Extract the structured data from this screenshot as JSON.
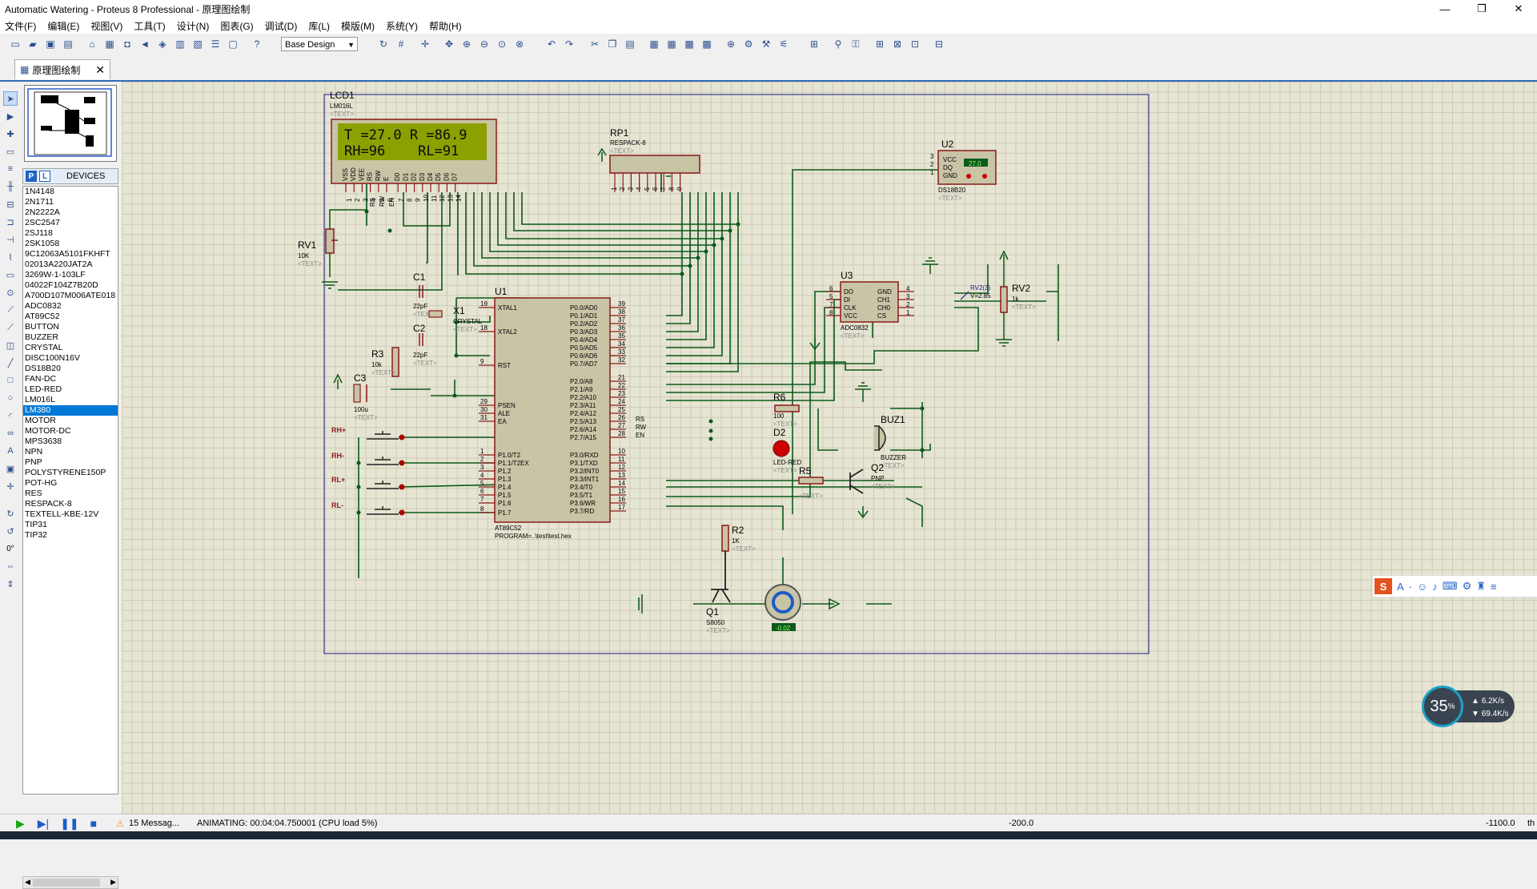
{
  "window": {
    "title": "Automatic Watering - Proteus 8 Professional - 原理图绘制",
    "buttons": [
      "—",
      "❐",
      "✕"
    ]
  },
  "menu": [
    "文件(F)",
    "编辑(E)",
    "视图(V)",
    "工具(T)",
    "设计(N)",
    "图表(G)",
    "调试(D)",
    "库(L)",
    "模版(M)",
    "系统(Y)",
    "帮助(H)"
  ],
  "toolbar": {
    "design_select": "Base Design"
  },
  "tab": {
    "label": "原理图绘制",
    "close": "✕"
  },
  "devices": {
    "header": "DEVICES",
    "p_label": "P",
    "l_label": "L",
    "selected": "LM380",
    "items": [
      "1N4148",
      "2N1711",
      "2N2222A",
      "2SC2547",
      "2SJ118",
      "2SK1058",
      "9C12063A5101FKHFT",
      "02013A220JAT2A",
      "3269W-1-103LF",
      "04022F104Z7B20D",
      "A700D107M006ATE018",
      "ADC0832",
      "AT89C52",
      "BUTTON",
      "BUZZER",
      "CRYSTAL",
      "DISC100N16V",
      "DS18B20",
      "FAN-DC",
      "LED-RED",
      "LM016L",
      "LM380",
      "MOTOR",
      "MOTOR-DC",
      "MPS3638",
      "NPN",
      "PNP",
      "POLYSTYRENE150P",
      "POT-HG",
      "RES",
      "RESPACK-8",
      "TEXTELL-KBE-12V",
      "TIP31",
      "TIP32"
    ]
  },
  "status": {
    "messages": "15 Messag...",
    "animating": "ANIMATING: 00:04:04.750001 (CPU load 5%)",
    "coord_x": "-200.0",
    "coord_y": "-1100.0",
    "unit": "th",
    "angle": "0°"
  },
  "overlay": {
    "cpu_percent": "35",
    "percent_sign": "%",
    "upload": "6.2",
    "download": "69.4",
    "rate_unit": "K/s"
  },
  "schematic": {
    "lcd": {
      "ref": "LCD1",
      "part": "LM016L",
      "text": "<TEXT>",
      "line1": "T =27.0 R =86.9",
      "line2": "RH=96    RL=91",
      "pins": [
        "VSS",
        "VDD",
        "VEE",
        "RS",
        "RW",
        "E",
        "D0",
        "D1",
        "D2",
        "D3",
        "D4",
        "D5",
        "D6",
        "D7"
      ],
      "pin_nums": [
        "1",
        "2",
        "3",
        "4",
        "5",
        "6",
        "7",
        "8",
        "9",
        "10",
        "11",
        "12",
        "13",
        "14"
      ]
    },
    "rp1": {
      "ref": "RP1",
      "part": "RESPACK-8",
      "text": "<TEXT>",
      "pins": [
        "1",
        "2",
        "3",
        "4",
        "5",
        "6",
        "7",
        "8",
        "9"
      ]
    },
    "u2": {
      "ref": "U2",
      "part": "DS18B20",
      "text": "<TEXT>",
      "pins": [
        "VCC",
        "DQ",
        "GND"
      ],
      "pin_nums": [
        "3",
        "2",
        "1"
      ],
      "display": "27.0"
    },
    "rv1": {
      "ref": "RV1",
      "value": "10K",
      "text": "<TEXT>"
    },
    "c1": {
      "ref": "C1",
      "value": "22pF",
      "text": "<TEXT>"
    },
    "c2": {
      "ref": "C2",
      "value": "22pF",
      "text": "<TEXT>"
    },
    "x1": {
      "ref": "X1",
      "part": "CRYSTAL",
      "text": "<TEXT>"
    },
    "r3": {
      "ref": "R3",
      "value": "10k",
      "text": "<TEXT>"
    },
    "c3": {
      "ref": "C3",
      "value": "100u",
      "text": "<TEXT>"
    },
    "u1": {
      "ref": "U1",
      "part": "AT89C52",
      "program": "PROGRAM=..\\test\\test.hex",
      "left_pins": [
        [
          "19",
          "XTAL1"
        ],
        [
          "18",
          "XTAL2"
        ],
        [
          "9",
          "RST"
        ],
        [
          "29",
          "PSEN"
        ],
        [
          "30",
          "ALE"
        ],
        [
          "31",
          "EA"
        ],
        [
          "1",
          "P1.0/T2"
        ],
        [
          "2",
          "P1.1/T2EX"
        ],
        [
          "3",
          "P1.2"
        ],
        [
          "4",
          "P1.3"
        ],
        [
          "5",
          "P1.4"
        ],
        [
          "6",
          "P1.5"
        ],
        [
          "7",
          "P1.6"
        ],
        [
          "8",
          "P1.7"
        ]
      ],
      "right_pins": [
        [
          "39",
          "P0.0/AD0"
        ],
        [
          "38",
          "P0.1/AD1"
        ],
        [
          "37",
          "P0.2/AD2"
        ],
        [
          "36",
          "P0.3/AD3"
        ],
        [
          "35",
          "P0.4/AD4"
        ],
        [
          "34",
          "P0.5/AD5"
        ],
        [
          "33",
          "P0.6/AD6"
        ],
        [
          "32",
          "P0.7/AD7"
        ],
        [
          "21",
          "P2.0/A8"
        ],
        [
          "22",
          "P2.1/A9"
        ],
        [
          "23",
          "P2.2/A10"
        ],
        [
          "24",
          "P2.3/A11"
        ],
        [
          "25",
          "P2.4/A12"
        ],
        [
          "26",
          "P2.5/A13"
        ],
        [
          "27",
          "P2.6/A14"
        ],
        [
          "28",
          "P2.7/A15"
        ],
        [
          "10",
          "P3.0/RXD"
        ],
        [
          "11",
          "P3.1/TXD"
        ],
        [
          "12",
          "P3.2/INT0"
        ],
        [
          "13",
          "P3.3/INT1"
        ],
        [
          "14",
          "P3.4/T0"
        ],
        [
          "15",
          "P3.5/T1"
        ],
        [
          "16",
          "P3.6/WR"
        ],
        [
          "17",
          "P3.7/RD"
        ]
      ]
    },
    "buttons": [
      "RH+",
      "RH-",
      "RL+",
      "RL-"
    ],
    "u3": {
      "ref": "U3",
      "part": "ADC0832",
      "text": "<TEXT>",
      "left": [
        [
          "6",
          "DO"
        ],
        [
          "5",
          "DI"
        ],
        [
          "7",
          "CLK"
        ],
        [
          "8",
          "VCC"
        ]
      ],
      "right": [
        [
          "4",
          "GND"
        ],
        [
          "3",
          "CH1"
        ],
        [
          "2",
          "CH0"
        ],
        [
          "1",
          "CS"
        ]
      ]
    },
    "rv2": {
      "ref": "RV2",
      "value": "1k",
      "text": "<TEXT>",
      "probe": "RV2(3)",
      "probe_v": "V=2.85"
    },
    "r6": {
      "ref": "R6",
      "value": "100",
      "text": "<TEXT>"
    },
    "d2": {
      "ref": "D2",
      "part": "LED-RED",
      "text": "<TEXT>"
    },
    "r5": {
      "ref": "R5",
      "text": "<TEXT>"
    },
    "buz1": {
      "ref": "BUZ1",
      "part": "BUZZER",
      "text": "<TEXT>"
    },
    "q2": {
      "ref": "Q2",
      "part": "PNP",
      "text": "<TEXT>"
    },
    "r2": {
      "ref": "R2",
      "value": "1K",
      "text": "<TEXT>"
    },
    "q1": {
      "ref": "Q1",
      "part": "S8050",
      "text": "<TEXT>"
    },
    "motor": {
      "reading": "-0.02"
    },
    "net_labels": [
      "RS",
      "RW",
      "EN"
    ]
  }
}
